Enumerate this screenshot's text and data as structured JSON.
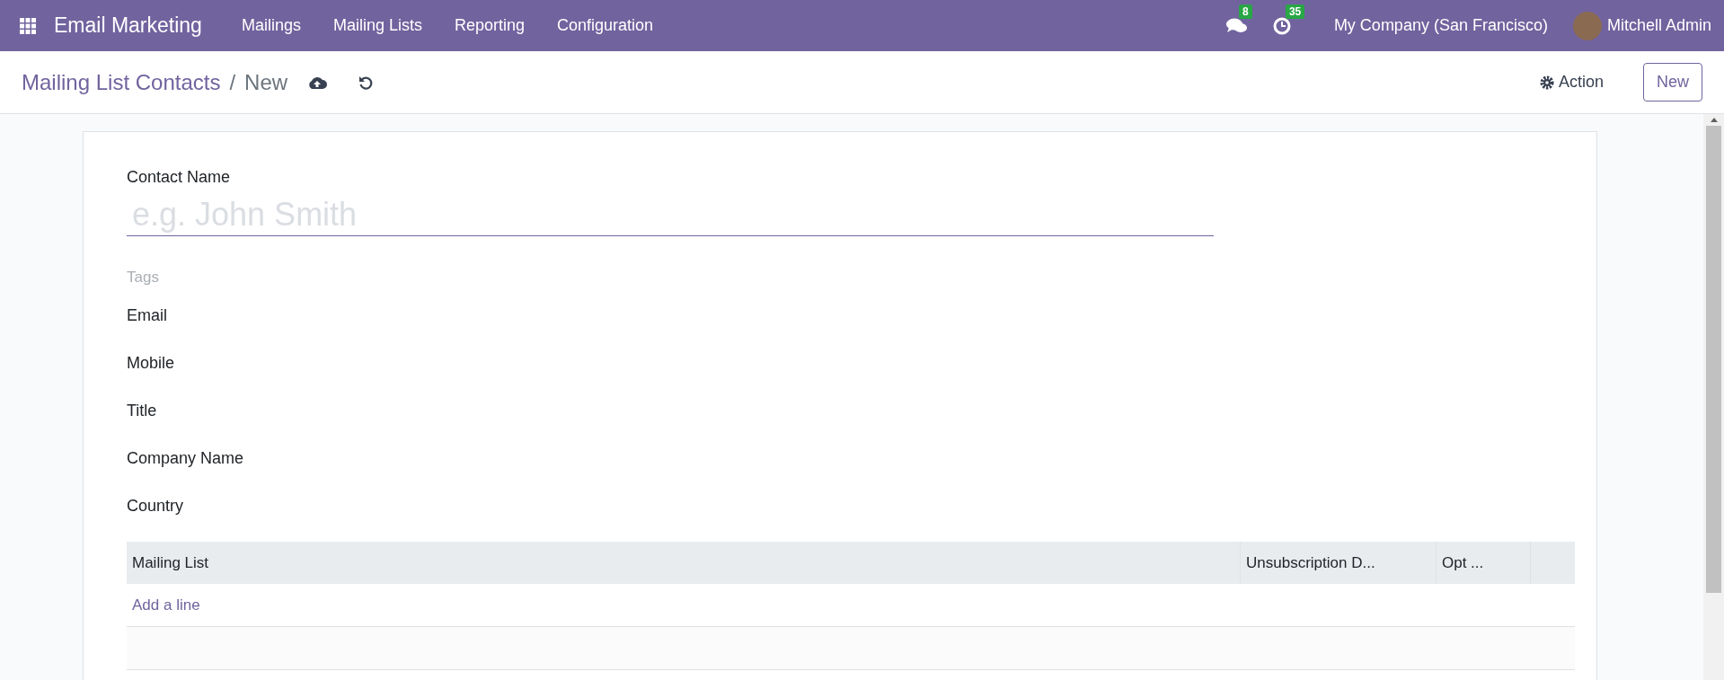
{
  "navbar": {
    "app_name": "Email Marketing",
    "menu": [
      "Mailings",
      "Mailing Lists",
      "Reporting",
      "Configuration"
    ],
    "messages_count": "8",
    "activities_count": "35",
    "company": "My Company (San Francisco)",
    "user": "Mitchell Admin"
  },
  "control_panel": {
    "breadcrumb": "Mailing List Contacts",
    "separator": "/",
    "current": "New",
    "action_label": "Action",
    "new_button": "New"
  },
  "form": {
    "name_label": "Contact Name",
    "name_placeholder": "e.g. John Smith",
    "tags_placeholder": "Tags",
    "fields": [
      "Email",
      "Mobile",
      "Title",
      "Company Name",
      "Country"
    ],
    "table": {
      "columns": [
        "Mailing List",
        "Unsubscription D...",
        "Opt ..."
      ],
      "add_line": "Add a line"
    }
  }
}
